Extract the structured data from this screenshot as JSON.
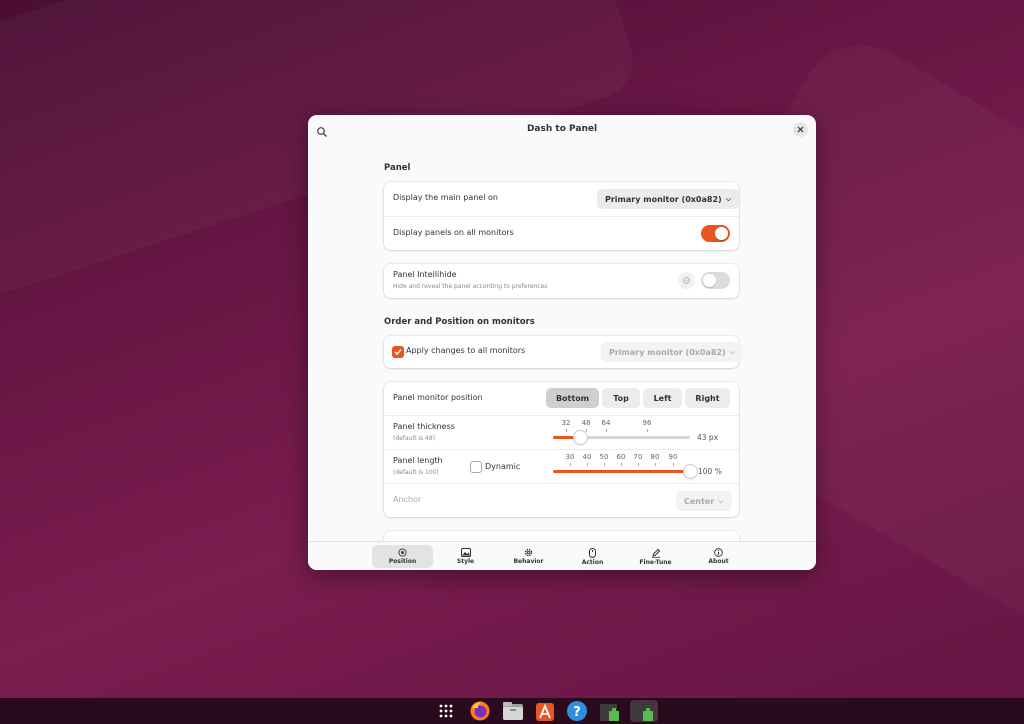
{
  "window": {
    "title": "Dash to Panel"
  },
  "panel_section": {
    "title": "Panel",
    "display_main_panel_label": "Display the main panel on",
    "display_main_panel_value": "Primary monitor (0x0a82)",
    "display_all_monitors_label": "Display panels on all monitors",
    "display_all_monitors_on": true
  },
  "intellihide": {
    "label": "Panel Intellihide",
    "description": "Hide and reveal the panel according to preferences",
    "enabled": false
  },
  "order_section": {
    "title": "Order and Position on monitors",
    "apply_all_label": "Apply changes to all monitors",
    "apply_all_checked": true,
    "monitor_value": "Primary monitor (0x0a82)"
  },
  "position_card": {
    "position_label": "Panel monitor position",
    "positions": [
      "Bottom",
      "Top",
      "Left",
      "Right"
    ],
    "selected_position": "Bottom",
    "thickness_label": "Panel thickness",
    "thickness_default": "(default is 48)",
    "thickness_marks": [
      "32",
      "48",
      "64",
      "96"
    ],
    "thickness_value": "43 px",
    "length_label": "Panel length",
    "length_default": "(default is 100)",
    "dynamic_label": "Dynamic",
    "dynamic_checked": false,
    "length_marks": [
      "30",
      "40",
      "50",
      "60",
      "70",
      "80",
      "90"
    ],
    "length_value": "100 %",
    "anchor_label": "Anchor",
    "anchor_value": "Center"
  },
  "nav": {
    "items": [
      {
        "label": "Position",
        "icon": "position-icon"
      },
      {
        "label": "Style",
        "icon": "image-icon"
      },
      {
        "label": "Behavior",
        "icon": "gear-icon"
      },
      {
        "label": "Action",
        "icon": "mouse-icon"
      },
      {
        "label": "Fine-Tune",
        "icon": "pen-icon"
      },
      {
        "label": "About",
        "icon": "info-icon"
      }
    ],
    "active": "Position"
  },
  "dock": {
    "icons": [
      "app-grid-icon",
      "firefox-icon",
      "files-icon",
      "app-center-icon",
      "help-icon",
      "extensions-icon",
      "extensions-active-icon"
    ]
  },
  "colors": {
    "accent": "#e95420",
    "wallpaper": "#6a1746"
  }
}
